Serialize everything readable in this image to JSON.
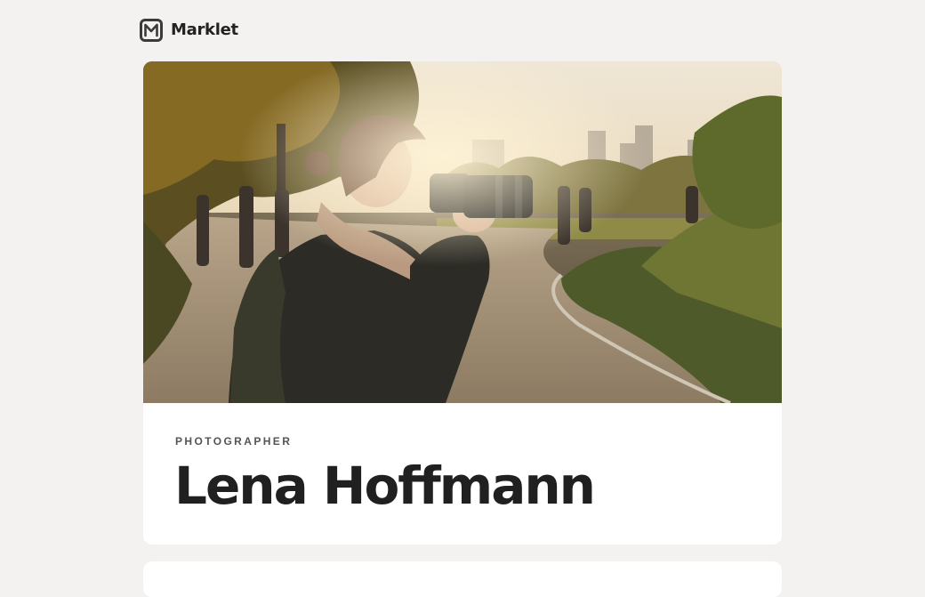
{
  "header": {
    "brand": "Marklet",
    "logo_icon": "m-logo-icon"
  },
  "profile": {
    "role": "PHOTOGRAPHER",
    "name": "Lena Hoffmann",
    "hero_image": "photographer-in-park-photo"
  }
}
